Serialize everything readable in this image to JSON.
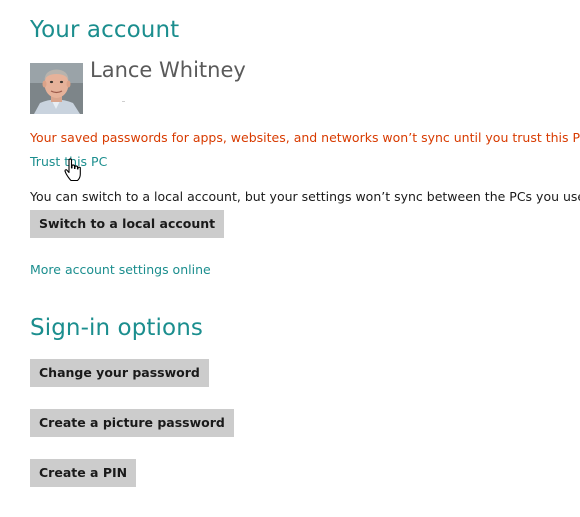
{
  "account": {
    "section_title": "Your account",
    "user_name": "Lance Whitney",
    "warning_text": "Your saved passwords for apps, websites, and networks won’t sync until you trust this PC.",
    "trust_link": "Trust this PC",
    "switch_info": "You can switch to a local account, but your settings won’t sync between the PCs you use.",
    "switch_button": "Switch to a local account",
    "more_settings_link": "More account settings online"
  },
  "signin": {
    "section_title": "Sign-in options",
    "change_password_button": "Change your password",
    "picture_password_button": "Create a picture password",
    "pin_button": "Create a PIN"
  },
  "colors": {
    "accent": "#1b8e8e",
    "warning": "#d83b01",
    "button_bg": "#cccccc"
  },
  "icons": {
    "cursor": "hand-pointer-icon",
    "avatar": "user-photo"
  }
}
